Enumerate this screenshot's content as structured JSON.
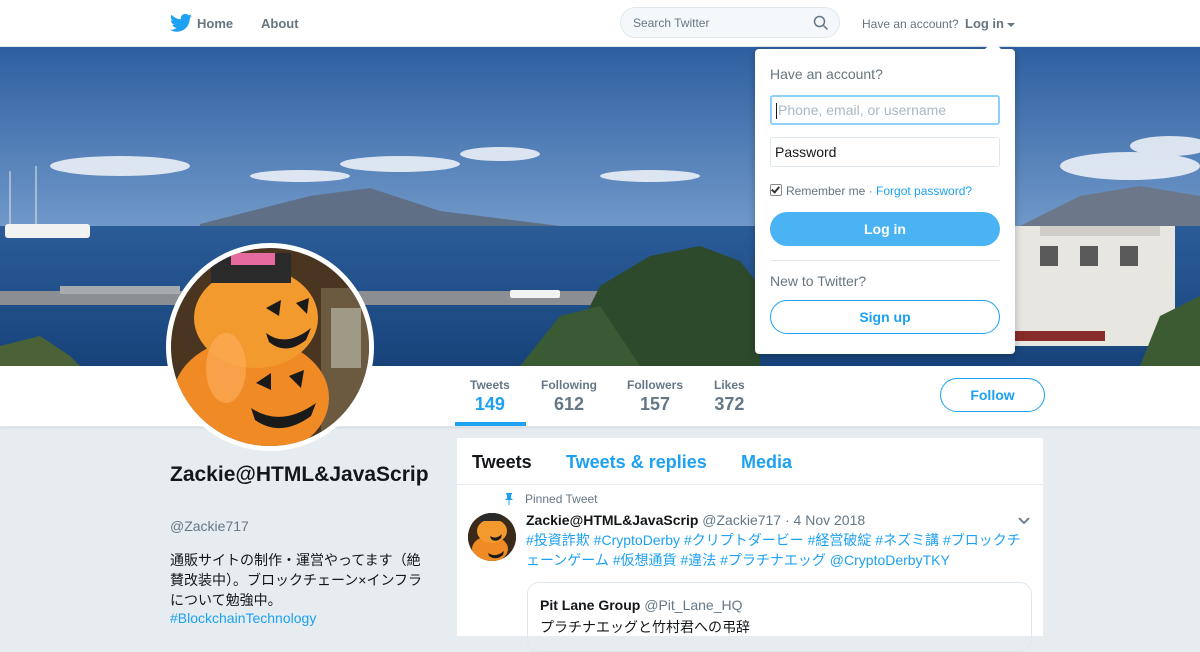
{
  "nav": {
    "home_label": "Home",
    "about_label": "About",
    "search_placeholder": "Search Twitter",
    "have_account": "Have an account?",
    "login_label": "Log in"
  },
  "profile": {
    "name": "Zackie@HTML&JavaScrip",
    "handle": "@Zackie717",
    "bio": "通販サイトの制作・運営やってます（絶賛改装中）。ブロックチェーン×インフラについて勉強中。",
    "hashtag": "#BlockchainTechnology",
    "follow_label": "Follow"
  },
  "stats": [
    {
      "label": "Tweets",
      "value": "149"
    },
    {
      "label": "Following",
      "value": "612"
    },
    {
      "label": "Followers",
      "value": "157"
    },
    {
      "label": "Likes",
      "value": "372"
    }
  ],
  "timeline": {
    "tabs": [
      "Tweets",
      "Tweets & replies",
      "Media"
    ],
    "pinned_label": "Pinned Tweet",
    "tweet": {
      "name": "Zackie@HTML&JavaScrip",
      "handle": "@Zackie717",
      "date": "· 4 Nov 2018",
      "text": "#投資詐欺 #CryptoDerby #クリプトダービー #経営破綻 #ネズミ講 #ブロックチェーンゲーム #仮想通貨 #違法 #プラチナエッグ  @CryptoDerbyTKY",
      "quote": {
        "name": "Pit Lane Group",
        "handle": "@Pit_Lane_HQ",
        "text": "プラチナエッグと竹村君への弔辞"
      }
    }
  },
  "login_dropdown": {
    "title": "Have an account?",
    "username_placeholder": "Phone, email, or username",
    "password_placeholder": "Password",
    "remember_label": "Remember me",
    "separator": " · ",
    "forgot_label": "Forgot password?",
    "login_button": "Log in",
    "new_label": "New to Twitter?",
    "signup_button": "Sign up"
  },
  "colors": {
    "accent": "#1da1f2",
    "login_button": "#4ab3f4",
    "background": "#e6ecf0"
  },
  "icons": [
    "twitter-bird-icon",
    "search-icon",
    "pin-icon",
    "chevron-down-icon"
  ]
}
